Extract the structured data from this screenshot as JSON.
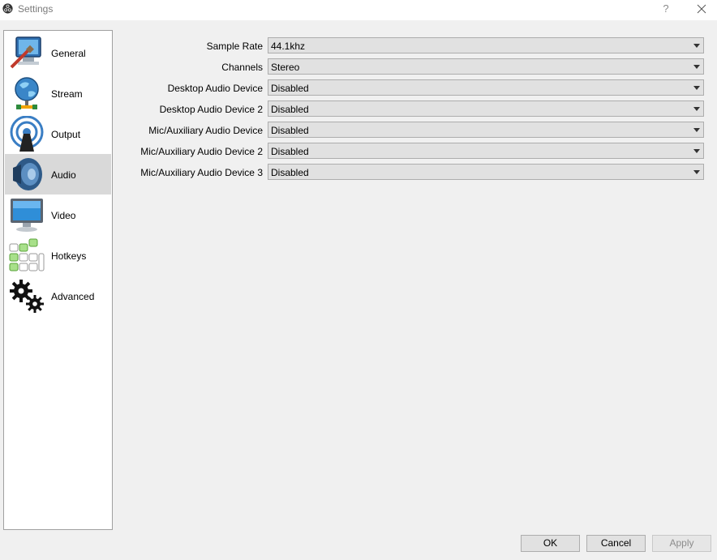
{
  "window": {
    "title": "Settings",
    "help_glyph": "?"
  },
  "sidebar": {
    "items": [
      {
        "label": "General",
        "icon": "general-monitor-icon"
      },
      {
        "label": "Stream",
        "icon": "stream-globe-icon"
      },
      {
        "label": "Output",
        "icon": "output-broadcast-icon"
      },
      {
        "label": "Audio",
        "icon": "audio-speaker-icon",
        "selected": true
      },
      {
        "label": "Video",
        "icon": "video-monitor-icon"
      },
      {
        "label": "Hotkeys",
        "icon": "hotkeys-keyboard-icon"
      },
      {
        "label": "Advanced",
        "icon": "advanced-gears-icon"
      }
    ]
  },
  "audio": {
    "fields": [
      {
        "label": "Sample Rate",
        "value": "44.1khz"
      },
      {
        "label": "Channels",
        "value": "Stereo"
      },
      {
        "label": "Desktop Audio Device",
        "value": "Disabled"
      },
      {
        "label": "Desktop Audio Device 2",
        "value": "Disabled"
      },
      {
        "label": "Mic/Auxiliary Audio Device",
        "value": "Disabled"
      },
      {
        "label": "Mic/Auxiliary Audio Device 2",
        "value": "Disabled"
      },
      {
        "label": "Mic/Auxiliary Audio Device 3",
        "value": "Disabled"
      }
    ]
  },
  "buttons": {
    "ok": "OK",
    "cancel": "Cancel",
    "apply": "Apply",
    "apply_enabled": false
  }
}
